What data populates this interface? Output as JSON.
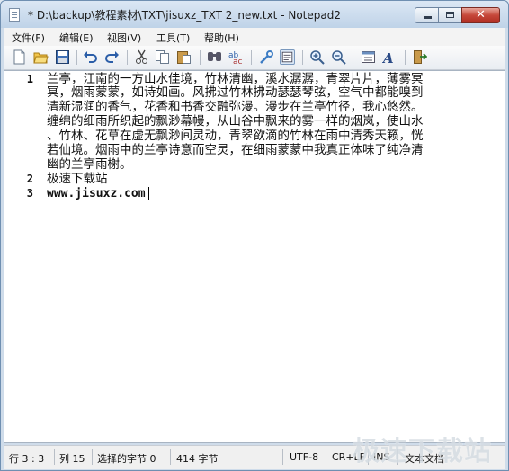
{
  "window": {
    "title": "* D:\\backup\\教程素材\\TXT\\jisuxz_TXT 2_new.txt - Notepad2",
    "close_glyph": "✕"
  },
  "menu": {
    "items": [
      {
        "label": "文件(F)"
      },
      {
        "label": "编辑(E)"
      },
      {
        "label": "视图(V)"
      },
      {
        "label": "工具(T)"
      },
      {
        "label": "帮助(H)"
      }
    ]
  },
  "toolbar": {
    "buttons": [
      "new-icon",
      "open-icon",
      "save-icon",
      "undo-icon",
      "redo-icon",
      "cut-icon",
      "copy-icon",
      "paste-icon",
      "find-icon",
      "replace-icon",
      "wordwrap-icon",
      "view-icon",
      "zoom-in-icon",
      "zoom-out-icon",
      "scheme-icon",
      "font-icon",
      "exit-icon"
    ],
    "pressed": "view-icon"
  },
  "editor": {
    "line_numbers": [
      "1",
      "2",
      "3"
    ],
    "wrapped_lines": [
      "兰亭，江南的一方山水佳境，竹林清幽，溪水潺潺，青翠片片，薄雾冥",
      "冥，烟雨蒙蒙，如诗如画。风拂过竹林拂动瑟瑟琴弦，空气中都能嗅到",
      "清新湿润的香气，花香和书香交融弥漫。漫步在兰亭竹径，我心悠然。",
      "缠绵的细雨所织起的飘渺幕幔，从山谷中飘来的雾一样的烟岚，使山水",
      "、竹林、花草在虚无飘渺间灵动，青翠欲滴的竹林在雨中清秀天籁，恍",
      "若仙境。烟雨中的兰亭诗意而空灵，在细雨蒙蒙中我真正体味了纯净清",
      "幽的兰亭雨榭。",
      "极速下载站",
      "www.jisuxz.com"
    ]
  },
  "status": {
    "row": "行 3 : 3",
    "col": "列 15",
    "selected": "选择的字节 0",
    "bytes": "414 字节",
    "encoding": "UTF-8",
    "eol": "CR+LF",
    "ins": "INS",
    "mode": "文本文档"
  },
  "watermark": {
    "text": "极速下载站"
  }
}
